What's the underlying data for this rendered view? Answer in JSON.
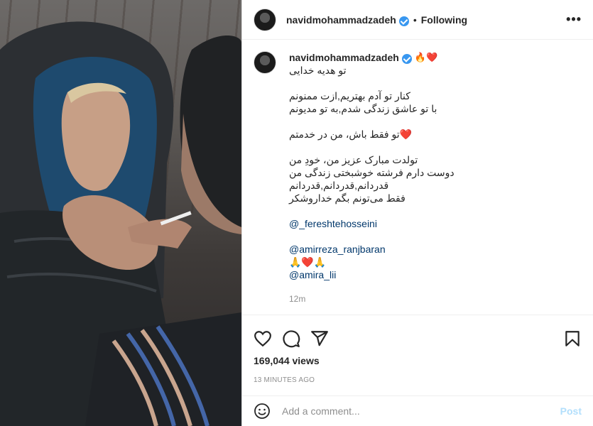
{
  "header": {
    "username": "navidmohammadzadeh",
    "separator": "•",
    "follow_status": "Following",
    "more_label": "•••"
  },
  "caption": {
    "username": "navidmohammadzadeh",
    "emojis": "🔥❤️",
    "lines": [
      "تو هدیه خدایی",
      "",
      "کنار تو آدم بهتریم,ازت ممنونم",
      "با تو عاشق زندگی شدم,به تو مدیونم",
      "",
      "❤️تو فقط باش، من در خدمتم",
      "",
      "تولدت مبارک عزیز من، خودِ من",
      "دوست دارم فرشته خوشبختی زندگی من",
      "قدردانم,قدردانم,قدردانم",
      "فقط می‌تونم بگم خداروشکر"
    ],
    "mentions": {
      "first": "@_fereshtehosseini",
      "second": "@amirreza_ranjbaran",
      "emoji_row": "🙏❤️🙏",
      "third": "@amira_lii"
    },
    "time": "12m"
  },
  "stats": {
    "views": "169,044 views",
    "posted": "13 MINUTES AGO"
  },
  "comment": {
    "placeholder": "Add a comment...",
    "post_label": "Post"
  },
  "colors": {
    "verified": "#3897f0",
    "mention": "#00376b",
    "post_disabled": "#b2dffc",
    "muted": "#8e8e8e"
  },
  "icons": [
    "verified-badge-icon",
    "heart-icon",
    "comment-icon",
    "share-icon",
    "bookmark-icon",
    "smiley-icon",
    "more-options-icon"
  ]
}
